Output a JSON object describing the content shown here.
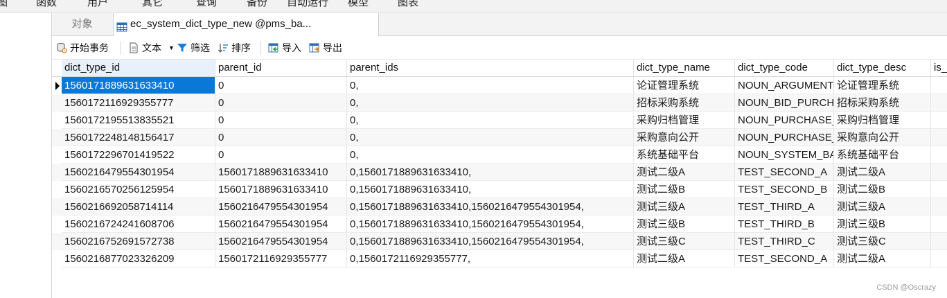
{
  "menu": {
    "items": [
      "图",
      "函数",
      "用户",
      "其它",
      "查询",
      "备份",
      "自动运行",
      "模型",
      "图表"
    ]
  },
  "tabs": {
    "objects_label": "对象",
    "active_label": "ec_system_dict_type_new @pms_ba..."
  },
  "toolbar": {
    "begin_transaction": "开始事务",
    "text": "文本",
    "filter": "筛选",
    "sort": "排序",
    "import": "导入",
    "export": "导出"
  },
  "table": {
    "columns": [
      "dict_type_id",
      "parent_id",
      "parent_ids",
      "dict_type_name",
      "dict_type_code",
      "dict_type_desc",
      "is_"
    ],
    "rows": [
      [
        "1560171889631633410",
        "0",
        "0,",
        "论证管理系统",
        "NOUN_ARGUMENT",
        "论证管理系统",
        ""
      ],
      [
        "1560172116929355777",
        "0",
        "0,",
        "招标采购系统",
        "NOUN_BID_PURCH/",
        "招标采购系统",
        ""
      ],
      [
        "1560172195513835521",
        "0",
        "0,",
        "采购归档管理",
        "NOUN_PURCHASE_",
        "采购归档管理",
        ""
      ],
      [
        "1560172248148156417",
        "0",
        "0,",
        "采购意向公开",
        "NOUN_PURCHASE_",
        "采购意向公开",
        ""
      ],
      [
        "1560172296701419522",
        "0",
        "0,",
        "系统基础平台",
        "NOUN_SYSTEM_BA",
        "系统基础平台",
        ""
      ],
      [
        "1560216479554301954",
        "1560171889631633410",
        "0,1560171889631633410,",
        "测试二级A",
        "TEST_SECOND_A",
        "测试二级A",
        ""
      ],
      [
        "1560216570256125954",
        "1560171889631633410",
        "0,1560171889631633410,",
        "测试二级B",
        "TEST_SECOND_B",
        "测试二级B",
        ""
      ],
      [
        "1560216692058714114",
        "1560216479554301954",
        "0,1560171889631633410,1560216479554301954,",
        "测试三级A",
        "TEST_THIRD_A",
        "测试三级A",
        ""
      ],
      [
        "1560216724241608706",
        "1560216479554301954",
        "0,1560171889631633410,1560216479554301954,",
        "测试三级B",
        "TEST_THIRD_B",
        "测试三级B",
        ""
      ],
      [
        "1560216752691572738",
        "1560216479554301954",
        "0,1560171889631633410,1560216479554301954,",
        "测试三级C",
        "TEST_THIRD_C",
        "测试三级C",
        ""
      ],
      [
        "1560216877023326209",
        "1560172116929355777",
        "0,1560172116929355777,",
        "测试二级A",
        "TEST_SECOND_A",
        "测试二级A",
        ""
      ]
    ],
    "selected_row": 0
  },
  "watermark": "CSDN @Oscrazy",
  "colors": {
    "selection": "#0a78d7",
    "header_sorted": "#e8f1fb",
    "filter_icon": "#1c7fd6"
  }
}
